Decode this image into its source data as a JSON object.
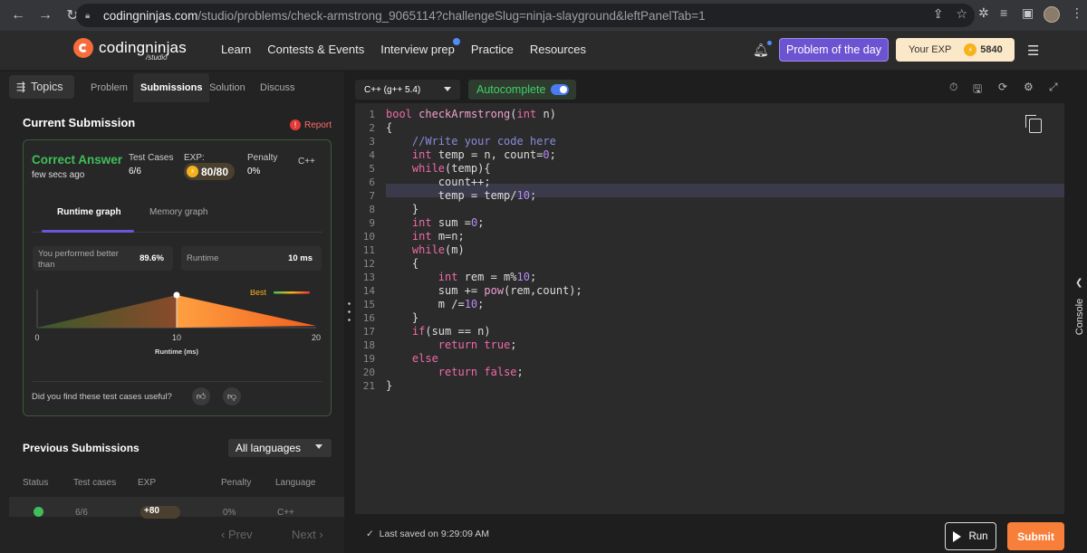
{
  "browser": {
    "url_host": "codingninjas.com",
    "url_path": "/studio/problems/check-armstrong_9065114?challengeSlug=ninja-slayground&leftPanelTab=1"
  },
  "header": {
    "logo_text": "codingninjas",
    "logo_sub": "/studio",
    "nav": [
      "Learn",
      "Contests & Events",
      "Interview prep",
      "Practice",
      "Resources"
    ],
    "problem_of_day": "Problem of the day",
    "exp_label": "Your EXP",
    "exp_value": "5840"
  },
  "left": {
    "topics": "Topics",
    "tabs": [
      "Problem",
      "Submissions",
      "Solution",
      "Discuss"
    ],
    "current_title": "Current Submission",
    "report": "Report",
    "result": {
      "status": "Correct Answer",
      "time": "few secs ago",
      "tc_label": "Test Cases",
      "tc_value": "6/6",
      "exp_label": "EXP:",
      "exp_value": "80/80",
      "penalty_label": "Penalty",
      "penalty_value": "0%",
      "language": "C++"
    },
    "graph_tabs": [
      "Runtime graph",
      "Memory graph"
    ],
    "performed_label": "You performed better than",
    "performed_value": "89.6%",
    "runtime_label": "Runtime",
    "runtime_value": "10 ms",
    "graph": {
      "best_label": "Best",
      "ticks": [
        "0",
        "10",
        "20"
      ],
      "xlabel": "Runtime (ms)",
      "marker_value": 10,
      "xrange": [
        0,
        20
      ]
    },
    "feedback": "Did you find these test cases useful?",
    "prev_title": "Previous Submissions",
    "lang_filter": "All languages",
    "table_headers": [
      "Status",
      "Test cases",
      "EXP",
      "Penalty",
      "Language"
    ],
    "row": {
      "tc": "6/6",
      "exp": "+80",
      "penalty": "0%",
      "lang": "C++"
    },
    "prev": "Prev",
    "next": "Next"
  },
  "editor": {
    "language": "C++ (g++ 5.4)",
    "autocomplete": "Autocomplete",
    "autocomplete_on": true,
    "line_numbers": [
      "1",
      "2",
      "3",
      "4",
      "5",
      "6",
      "7",
      "8",
      "9",
      "10",
      "11",
      "12",
      "13",
      "14",
      "15",
      "16",
      "17",
      "18",
      "19",
      "20",
      "21"
    ],
    "highlighted_line": 7,
    "saved": "Last saved on 9:29:09 AM",
    "run": "Run",
    "submit": "Submit"
  },
  "console_label": "Console",
  "icons": [
    "back-icon",
    "forward-icon",
    "reload-icon",
    "lock-icon",
    "share-icon",
    "star-icon",
    "extension-icon",
    "playlist-icon",
    "sidepanel-icon",
    "bell-icon",
    "menu-icon",
    "topics-icon",
    "report-icon",
    "coin-icon",
    "thumbs-up-icon",
    "thumbs-down-icon",
    "timer-icon",
    "save-icon",
    "reset-icon",
    "settings-icon",
    "fullscreen-icon",
    "copy-icon",
    "check-icon",
    "play-icon",
    "chevron-left-icon"
  ],
  "colors": {
    "accent": "#6c53d1",
    "success": "#3fbf5a",
    "brand": "#f66c3b",
    "submit": "#f77f3a"
  }
}
